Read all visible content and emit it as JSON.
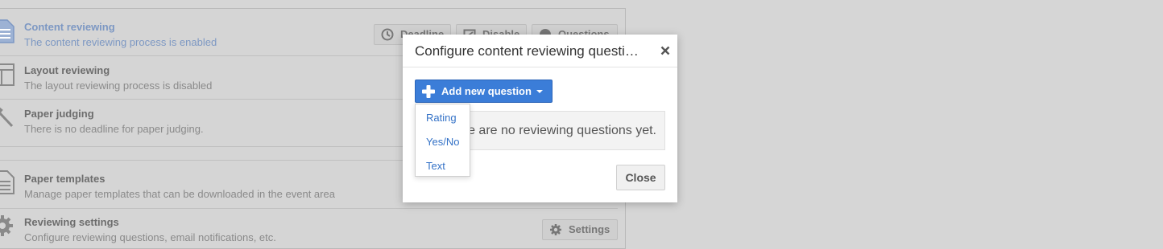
{
  "background": {
    "rows": [
      {
        "title": "Content reviewing",
        "desc": "The content reviewing process is enabled",
        "icon": "document-icon"
      },
      {
        "title": "Layout reviewing",
        "desc": "The layout reviewing process is disabled",
        "icon": "layout-icon"
      },
      {
        "title": "Paper judging",
        "desc": "There is no deadline for paper judging.",
        "icon": "gavel-icon"
      },
      {
        "title": "Paper templates",
        "desc": "Manage paper templates that can be downloaded in the event area",
        "icon": "template-icon"
      },
      {
        "title": "Reviewing settings",
        "desc": "Configure reviewing questions, email notifications, etc.",
        "icon": "gear-icon"
      }
    ],
    "buttons": {
      "deadline": "Deadline",
      "disable": "Disable",
      "questions": "Questions",
      "settings": "Settings"
    }
  },
  "dialog": {
    "title": "Configure content reviewing questions",
    "add_button": "Add new question",
    "menu": [
      "Rating",
      "Yes/No",
      "Text"
    ],
    "empty_message": "There are no reviewing questions yet.",
    "close_button": "Close"
  },
  "colors": {
    "primary": "#3b7dd8",
    "link": "#3472c7",
    "overlay": "#d6d6d6"
  }
}
